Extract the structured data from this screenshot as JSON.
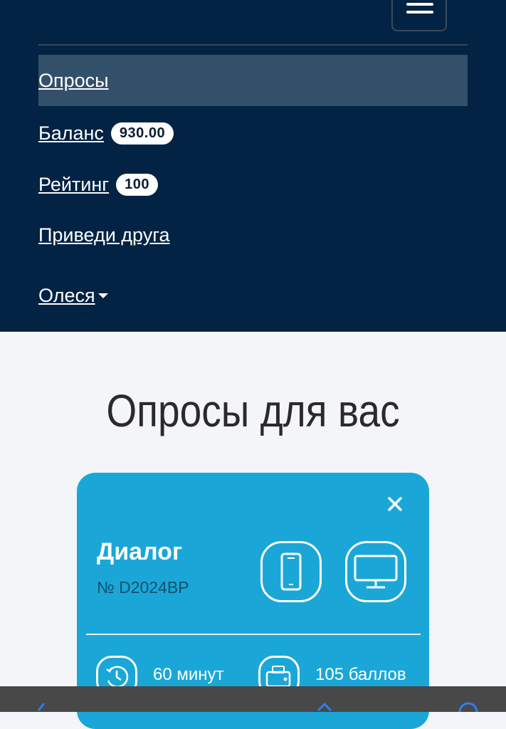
{
  "nav": {
    "menu_toggle_icon": "hamburger-icon",
    "items": [
      {
        "label": "Опросы",
        "badge": null
      },
      {
        "label": "Баланс",
        "badge": "930.00"
      },
      {
        "label": "Рейтинг",
        "badge": "100"
      },
      {
        "label": "Приведи друга",
        "badge": null
      }
    ],
    "user": {
      "name": "Олеся",
      "icon": "caret-down-icon"
    }
  },
  "main": {
    "title": "Опросы для вас",
    "survey_card": {
      "name": "Диалог",
      "code": "№ D2024BP",
      "devices": [
        "smartphone-icon",
        "desktop-icon"
      ],
      "duration": "60 минут",
      "reward": "105 баллов",
      "close_icon": "close-icon"
    }
  },
  "colors": {
    "nav_bg": "#022343",
    "nav_active_bg": "#33506a",
    "card_bg": "#1aa7d8",
    "page_bg": "#f4f5f8",
    "bottom_bar": "#484848"
  }
}
